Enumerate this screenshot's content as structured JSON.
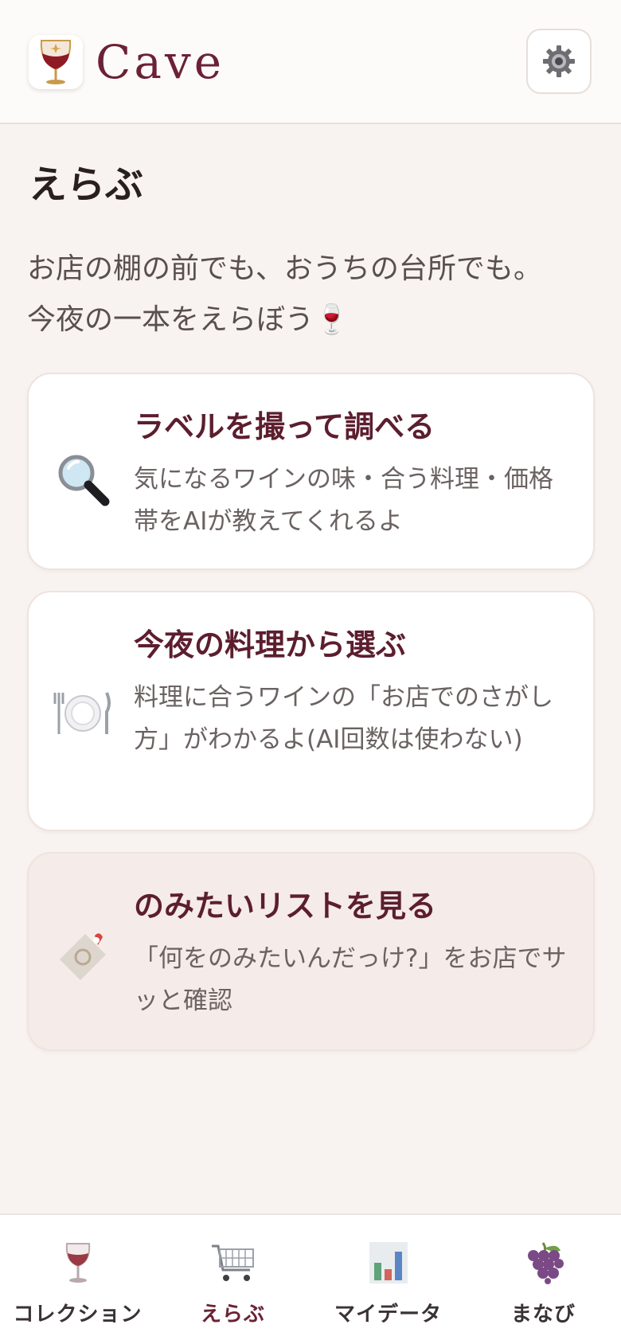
{
  "header": {
    "app_title": "Cave"
  },
  "page": {
    "title": "えらぶ",
    "intro_line1": "お店の棚の前でも、おうちの台所でも。",
    "intro_line2": "今夜の一本をえらぼう🍷"
  },
  "cards": [
    {
      "icon": "magnifier-icon",
      "title": "ラベルを撮って調べる",
      "description": "気になるワインの味・合う料理・価格帯をAIが教えてくれるよ"
    },
    {
      "icon": "plate-cutlery-icon",
      "title": "今夜の料理から選ぶ",
      "description": "料理に合うワインの「お店でのさがし方」がわかるよ(AI回数は使わない)"
    },
    {
      "icon": "tag-icon",
      "title": "のみたいリストを見る",
      "description": "「何をのみたいんだっけ?」をお店でサッと確認"
    }
  ],
  "nav": {
    "items": [
      {
        "label": "コレクション",
        "icon": "wine-glass-icon"
      },
      {
        "label": "えらぶ",
        "icon": "shopping-cart-icon",
        "active": true
      },
      {
        "label": "マイデータ",
        "icon": "bar-chart-icon"
      },
      {
        "label": "まなび",
        "icon": "grapes-icon"
      }
    ]
  },
  "colors": {
    "brand": "#6b2234",
    "background": "#f8f3f1",
    "card_title": "#5c1e2e"
  }
}
